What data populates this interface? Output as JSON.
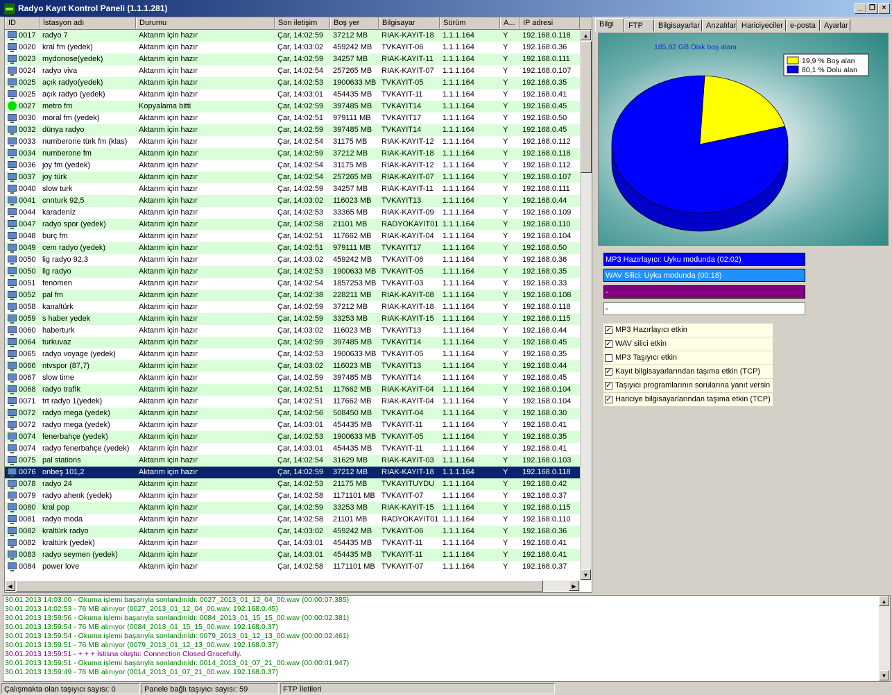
{
  "window": {
    "title": "Radyo Kayıt Kontrol Paneli (1.1.1.281)"
  },
  "grid": {
    "columns": [
      "ID",
      "İstasyon adı",
      "Durumu",
      "Son iletişim",
      "Boş yer",
      "Bilgisayar",
      "Sürüm",
      "A...",
      "IP adresi"
    ],
    "rows": [
      {
        "id": "0017",
        "name": "radyo 7",
        "status": "Aktarım için hazır",
        "last": "Çar, 14:02:59",
        "free": "37212 MB",
        "pc": "RIAK-KAYIT-18",
        "ver": "1.1.1.164",
        "a": "Y",
        "ip": "192.168.0.118",
        "icon": "pc",
        "bg": "g"
      },
      {
        "id": "0020",
        "name": "kral fm (yedek)",
        "status": "Aktarım için hazır",
        "last": "Çar, 14:03:02",
        "free": "459242 MB",
        "pc": "TVKAYIT-06",
        "ver": "1.1.1.164",
        "a": "Y",
        "ip": "192.168.0.36",
        "icon": "pc",
        "bg": "w"
      },
      {
        "id": "0023",
        "name": "mydonose(yedek)",
        "status": "Aktarım için hazır",
        "last": "Çar, 14:02:59",
        "free": "34257 MB",
        "pc": "RIAK-KAYIT-11",
        "ver": "1.1.1.164",
        "a": "Y",
        "ip": "192.168.0.111",
        "icon": "pc",
        "bg": "g"
      },
      {
        "id": "0024",
        "name": "radyo viva",
        "status": "Aktarım için hazır",
        "last": "Çar, 14:02:54",
        "free": "257265 MB",
        "pc": "RIAK-KAYIT-07",
        "ver": "1.1.1.164",
        "a": "Y",
        "ip": "192.168.0.107",
        "icon": "pc",
        "bg": "w"
      },
      {
        "id": "0025",
        "name": "açık radyo(yedek)",
        "status": "Aktarım için hazır",
        "last": "Çar, 14:02:53",
        "free": "1900633 MB",
        "pc": "TVKAYIT-05",
        "ver": "1.1.1.164",
        "a": "Y",
        "ip": "192.168.0.35",
        "icon": "pc",
        "bg": "g"
      },
      {
        "id": "0025",
        "name": "açık radyo (yedek)",
        "status": "Aktarım için hazır",
        "last": "Çar, 14:03:01",
        "free": "454435 MB",
        "pc": "TVKAYIT-11",
        "ver": "1.1.1.164",
        "a": "Y",
        "ip": "192.168.0.41",
        "icon": "pc",
        "bg": "w"
      },
      {
        "id": "0027",
        "name": "metro fm",
        "status": "Kopyalama bitti",
        "last": "Çar, 14:02:59",
        "free": "397485 MB",
        "pc": "TVKAYIT14",
        "ver": "1.1.1.164",
        "a": "Y",
        "ip": "192.168.0.45",
        "icon": "dot",
        "bg": "g"
      },
      {
        "id": "0030",
        "name": "moral fm (yedek)",
        "status": "Aktarım için hazır",
        "last": "Çar, 14:02:51",
        "free": "979111 MB",
        "pc": "TVKAYIT17",
        "ver": "1.1.1.164",
        "a": "Y",
        "ip": "192.168.0.50",
        "icon": "pc",
        "bg": "w"
      },
      {
        "id": "0032",
        "name": "dünya radyo",
        "status": "Aktarım için hazır",
        "last": "Çar, 14:02:59",
        "free": "397485 MB",
        "pc": "TVKAYIT14",
        "ver": "1.1.1.164",
        "a": "Y",
        "ip": "192.168.0.45",
        "icon": "pc",
        "bg": "g"
      },
      {
        "id": "0033",
        "name": "numberone türk fm (klas)",
        "status": "Aktarım için hazır",
        "last": "Çar, 14:02:54",
        "free": "31175 MB",
        "pc": "RIAK-KAYIT-12",
        "ver": "1.1.1.164",
        "a": "Y",
        "ip": "192.168.0.112",
        "icon": "pc",
        "bg": "w"
      },
      {
        "id": "0034",
        "name": "numberone fm",
        "status": "Aktarım için hazır",
        "last": "Çar, 14:02:59",
        "free": "37212 MB",
        "pc": "RIAK-KAYIT-18",
        "ver": "1.1.1.164",
        "a": "Y",
        "ip": "192.168.0.118",
        "icon": "pc",
        "bg": "g"
      },
      {
        "id": "0036",
        "name": "joy fm (yedek)",
        "status": "Aktarım için hazır",
        "last": "Çar, 14:02:54",
        "free": "31175 MB",
        "pc": "RIAK-KAYIT-12",
        "ver": "1.1.1.164",
        "a": "Y",
        "ip": "192.168.0.112",
        "icon": "pc",
        "bg": "w"
      },
      {
        "id": "0037",
        "name": "joy türk",
        "status": "Aktarım için hazır",
        "last": "Çar, 14:02:54",
        "free": "257265 MB",
        "pc": "RIAK-KAYIT-07",
        "ver": "1.1.1.164",
        "a": "Y",
        "ip": "192.168.0.107",
        "icon": "pc",
        "bg": "g"
      },
      {
        "id": "0040",
        "name": "slow turk",
        "status": "Aktarım için hazır",
        "last": "Çar, 14:02:59",
        "free": "34257 MB",
        "pc": "RIAK-KAYIT-11",
        "ver": "1.1.1.164",
        "a": "Y",
        "ip": "192.168.0.111",
        "icon": "pc",
        "bg": "w"
      },
      {
        "id": "0041",
        "name": "cnnturk 92,5",
        "status": "Aktarım için hazır",
        "last": "Çar, 14:03:02",
        "free": "116023 MB",
        "pc": "TVKAYIT13",
        "ver": "1.1.1.164",
        "a": "Y",
        "ip": "192.168.0.44",
        "icon": "pc",
        "bg": "g"
      },
      {
        "id": "0044",
        "name": "karadenİz",
        "status": "Aktarım için hazır",
        "last": "Çar, 14:02:53",
        "free": "33365 MB",
        "pc": "RIAK-KAYIT-09",
        "ver": "1.1.1.164",
        "a": "Y",
        "ip": "192.168.0.109",
        "icon": "pc",
        "bg": "w"
      },
      {
        "id": "0047",
        "name": "radyo spor (yedek)",
        "status": "Aktarım için hazır",
        "last": "Çar, 14:02:58",
        "free": "21101 MB",
        "pc": "RADYOKAYIT01",
        "ver": "1.1.1.164",
        "a": "Y",
        "ip": "192.168.0.110",
        "icon": "pc",
        "bg": "g"
      },
      {
        "id": "0048",
        "name": "burç fm",
        "status": "Aktarım için hazır",
        "last": "Çar, 14:02:51",
        "free": "117662 MB",
        "pc": "RIAK-KAYIT-04",
        "ver": "1.1.1.164",
        "a": "Y",
        "ip": "192.168.0.104",
        "icon": "pc",
        "bg": "w"
      },
      {
        "id": "0049",
        "name": "cem radyo (yedek)",
        "status": "Aktarım için hazır",
        "last": "Çar, 14:02:51",
        "free": "979111 MB",
        "pc": "TVKAYIT17",
        "ver": "1.1.1.164",
        "a": "Y",
        "ip": "192.168.0.50",
        "icon": "pc",
        "bg": "g"
      },
      {
        "id": "0050",
        "name": "lig radyo 92,3",
        "status": "Aktarım için hazır",
        "last": "Çar, 14:03:02",
        "free": "459242 MB",
        "pc": "TVKAYIT-06",
        "ver": "1.1.1.164",
        "a": "Y",
        "ip": "192.168.0.36",
        "icon": "pc",
        "bg": "w"
      },
      {
        "id": "0050",
        "name": "lig radyo",
        "status": "Aktarım için hazır",
        "last": "Çar, 14:02:53",
        "free": "1900633 MB",
        "pc": "TVKAYIT-05",
        "ver": "1.1.1.164",
        "a": "Y",
        "ip": "192.168.0.35",
        "icon": "pc",
        "bg": "g"
      },
      {
        "id": "0051",
        "name": "fenomen",
        "status": "Aktarım için hazır",
        "last": "Çar, 14:02:54",
        "free": "1857253 MB",
        "pc": "TVKAYIT-03",
        "ver": "1.1.1.164",
        "a": "Y",
        "ip": "192.168.0.33",
        "icon": "pc",
        "bg": "w"
      },
      {
        "id": "0052",
        "name": "pal fm",
        "status": "Aktarım için hazır",
        "last": "Çar, 14:02:38",
        "free": "228211 MB",
        "pc": "RIAK-KAYIT-08",
        "ver": "1.1.1.164",
        "a": "Y",
        "ip": "192.168.0.108",
        "icon": "pc",
        "bg": "g"
      },
      {
        "id": "0058",
        "name": "kanaltürk",
        "status": "Aktarım için hazır",
        "last": "Çar, 14:02:59",
        "free": "37212 MB",
        "pc": "RIAK-KAYIT-18",
        "ver": "1.1.1.164",
        "a": "Y",
        "ip": "192.168.0.118",
        "icon": "pc",
        "bg": "w"
      },
      {
        "id": "0059",
        "name": "s haber yedek",
        "status": "Aktarım için hazır",
        "last": "Çar, 14:02:59",
        "free": "33253 MB",
        "pc": "RIAK-KAYIT-15",
        "ver": "1.1.1.164",
        "a": "Y",
        "ip": "192.168.0.115",
        "icon": "pc",
        "bg": "g"
      },
      {
        "id": "0060",
        "name": "haberturk",
        "status": "Aktarım için hazır",
        "last": "Çar, 14:03:02",
        "free": "116023 MB",
        "pc": "TVKAYIT13",
        "ver": "1.1.1.164",
        "a": "Y",
        "ip": "192.168.0.44",
        "icon": "pc",
        "bg": "w"
      },
      {
        "id": "0064",
        "name": "turkuvaz",
        "status": "Aktarım için hazır",
        "last": "Çar, 14:02:59",
        "free": "397485 MB",
        "pc": "TVKAYIT14",
        "ver": "1.1.1.164",
        "a": "Y",
        "ip": "192.168.0.45",
        "icon": "pc",
        "bg": "g"
      },
      {
        "id": "0065",
        "name": "radyo voyage (yedek)",
        "status": "Aktarım için hazır",
        "last": "Çar, 14:02:53",
        "free": "1900633 MB",
        "pc": "TVKAYIT-05",
        "ver": "1.1.1.164",
        "a": "Y",
        "ip": "192.168.0.35",
        "icon": "pc",
        "bg": "w"
      },
      {
        "id": "0066",
        "name": "ntvspor (87,7)",
        "status": "Aktarım için hazır",
        "last": "Çar, 14:03:02",
        "free": "116023 MB",
        "pc": "TVKAYIT13",
        "ver": "1.1.1.164",
        "a": "Y",
        "ip": "192.168.0.44",
        "icon": "pc",
        "bg": "g"
      },
      {
        "id": "0067",
        "name": "slow time",
        "status": "Aktarım için hazır",
        "last": "Çar, 14:02:59",
        "free": "397485 MB",
        "pc": "TVKAYIT14",
        "ver": "1.1.1.164",
        "a": "Y",
        "ip": "192.168.0.45",
        "icon": "pc",
        "bg": "w"
      },
      {
        "id": "0068",
        "name": "radyo trafİk",
        "status": "Aktarım için hazır",
        "last": "Çar, 14:02:51",
        "free": "117662 MB",
        "pc": "RIAK-KAYIT-04",
        "ver": "1.1.1.164",
        "a": "Y",
        "ip": "192.168.0.104",
        "icon": "pc",
        "bg": "g"
      },
      {
        "id": "0071",
        "name": "trt radyo 1(yedek)",
        "status": "Aktarım için hazır",
        "last": "Çar, 14:02:51",
        "free": "117662 MB",
        "pc": "RIAK-KAYIT-04",
        "ver": "1.1.1.164",
        "a": "Y",
        "ip": "192.168.0.104",
        "icon": "pc",
        "bg": "w"
      },
      {
        "id": "0072",
        "name": "radyo mega (yedek)",
        "status": "Aktarım için hazır",
        "last": "Çar, 14:02:56",
        "free": "508450 MB",
        "pc": "TVKAYIT-04",
        "ver": "1.1.1.164",
        "a": "Y",
        "ip": "192.168.0.30",
        "icon": "pc",
        "bg": "g"
      },
      {
        "id": "0072",
        "name": "radyo mega (yedek)",
        "status": "Aktarım için hazır",
        "last": "Çar, 14:03:01",
        "free": "454435 MB",
        "pc": "TVKAYIT-11",
        "ver": "1.1.1.164",
        "a": "Y",
        "ip": "192.168.0.41",
        "icon": "pc",
        "bg": "w"
      },
      {
        "id": "0074",
        "name": "fenerbahçe (yedek)",
        "status": "Aktarım için hazır",
        "last": "Çar, 14:02:53",
        "free": "1900633 MB",
        "pc": "TVKAYIT-05",
        "ver": "1.1.1.164",
        "a": "Y",
        "ip": "192.168.0.35",
        "icon": "pc",
        "bg": "g"
      },
      {
        "id": "0074",
        "name": "radyo fenerbahçe (yedek)",
        "status": "Aktarım için hazır",
        "last": "Çar, 14:03:01",
        "free": "454435 MB",
        "pc": "TVKAYIT-11",
        "ver": "1.1.1.164",
        "a": "Y",
        "ip": "192.168.0.41",
        "icon": "pc",
        "bg": "w"
      },
      {
        "id": "0075",
        "name": "pal stations",
        "status": "Aktarım için hazır",
        "last": "Çar, 14:02:54",
        "free": "31629 MB",
        "pc": "RIAK-KAYIT-03",
        "ver": "1.1.1.164",
        "a": "Y",
        "ip": "192.168.0.103",
        "icon": "pc",
        "bg": "g"
      },
      {
        "id": "0076",
        "name": "onbeş 101,2",
        "status": "Aktarım için hazır",
        "last": "Çar, 14:02:59",
        "free": "37212 MB",
        "pc": "RIAK-KAYIT-18",
        "ver": "1.1.1.164",
        "a": "Y",
        "ip": "192.168.0.118",
        "icon": "pc",
        "bg": "sel"
      },
      {
        "id": "0078",
        "name": "radyo 24",
        "status": "Aktarım için hazır",
        "last": "Çar, 14:02:53",
        "free": "21175 MB",
        "pc": "TVKAYITUYDU",
        "ver": "1.1.1.164",
        "a": "Y",
        "ip": "192.168.0.42",
        "icon": "pc",
        "bg": "g"
      },
      {
        "id": "0079",
        "name": "radyo ahenk (yedek)",
        "status": "Aktarım için hazır",
        "last": "Çar, 14:02:58",
        "free": "1171101 MB",
        "pc": "TVKAYIT-07",
        "ver": "1.1.1.164",
        "a": "Y",
        "ip": "192.168.0.37",
        "icon": "pc",
        "bg": "w"
      },
      {
        "id": "0080",
        "name": "kral pop",
        "status": "Aktarım için hazır",
        "last": "Çar, 14:02:59",
        "free": "33253 MB",
        "pc": "RIAK-KAYIT-15",
        "ver": "1.1.1.164",
        "a": "Y",
        "ip": "192.168.0.115",
        "icon": "pc",
        "bg": "g"
      },
      {
        "id": "0081",
        "name": "radyo moda",
        "status": "Aktarım için hazır",
        "last": "Çar, 14:02:58",
        "free": "21101 MB",
        "pc": "RADYOKAYIT01",
        "ver": "1.1.1.164",
        "a": "Y",
        "ip": "192.168.0.110",
        "icon": "pc",
        "bg": "w"
      },
      {
        "id": "0082",
        "name": "kraltürk radyo",
        "status": "Aktarım için hazır",
        "last": "Çar, 14:03:02",
        "free": "459242 MB",
        "pc": "TVKAYIT-06",
        "ver": "1.1.1.164",
        "a": "Y",
        "ip": "192.168.0.36",
        "icon": "pc",
        "bg": "g"
      },
      {
        "id": "0082",
        "name": "kraltürk (yedek)",
        "status": "Aktarım için hazır",
        "last": "Çar, 14:03:01",
        "free": "454435 MB",
        "pc": "TVKAYIT-11",
        "ver": "1.1.1.164",
        "a": "Y",
        "ip": "192.168.0.41",
        "icon": "pc",
        "bg": "w"
      },
      {
        "id": "0083",
        "name": "radyo seymen (yedek)",
        "status": "Aktarım için hazır",
        "last": "Çar, 14:03:01",
        "free": "454435 MB",
        "pc": "TVKAYIT-11",
        "ver": "1.1.1.164",
        "a": "Y",
        "ip": "192.168.0.41",
        "icon": "pc",
        "bg": "g"
      },
      {
        "id": "0084",
        "name": "power love",
        "status": "Aktarım için hazır",
        "last": "Çar, 14:02:58",
        "free": "1171101 MB",
        "pc": "TVKAYIT-07",
        "ver": "1.1.1.164",
        "a": "Y",
        "ip": "192.168.0.37",
        "icon": "pc",
        "bg": "w"
      }
    ]
  },
  "tabs": [
    "Bilgi",
    "FTP",
    "Bilgisayarlar",
    "Arızalılar",
    "Hariciyeciler",
    "e-posta",
    "Ayarlar"
  ],
  "chart_data": {
    "type": "pie",
    "title": "185,82 GB Disk boş alanı",
    "slices": [
      {
        "label": "19,9 % Boş alan",
        "value": 19.9,
        "color": "#ffff00"
      },
      {
        "label": "80,1 % Dolu alan",
        "value": 80.1,
        "color": "#0000ff"
      }
    ],
    "legend": "top-right"
  },
  "statusbars": [
    {
      "text": "MP3 Hazırlayıcı: Uyku modunda (02:02)",
      "color": "#0000ff"
    },
    {
      "text": "WAV Silici: Uyku modunda (00:18)",
      "color": "#1e90ff"
    },
    {
      "text": "-",
      "color": "#800080"
    },
    {
      "text": "-",
      "color": "#ffffff"
    }
  ],
  "checkboxes": [
    {
      "label": "MP3 Hazırlayıcı etkin",
      "checked": true
    },
    {
      "label": "WAV silici etkin",
      "checked": true
    },
    {
      "label": "MP3 Taşıyıcı etkin",
      "checked": false
    },
    {
      "label": "Kayıt bilgisayarlarından taşıma etkin (TCP)",
      "checked": true
    },
    {
      "label": "Taşıyıcı programlarının sorularına yanıt versin",
      "checked": true
    },
    {
      "label": "Hariciye bilgisayarlarından taşıma etkin (TCP)",
      "checked": true
    }
  ],
  "log": [
    {
      "text": "30.01.2013 14:03:00 - Okuma işlemi başarıyla sonlandırıldı: 0027_2013_01_12_04_00.wav (00:00:07.385)",
      "type": "ok"
    },
    {
      "text": "30.01.2013 14:02:53 - 76 MB alınıyor (0027_2013_01_12_04_00.wav, 192.168.0.45)",
      "type": "ok"
    },
    {
      "text": "30.01.2013 13:59:56 - Okuma işlemi başarıyla sonlandırıldı: 0084_2013_01_15_15_00.wav (00:00:02.381)",
      "type": "ok"
    },
    {
      "text": "30.01.2013 13:59:54 - 76 MB alınıyor (0084_2013_01_15_15_00.wav, 192.168.0.37)",
      "type": "ok"
    },
    {
      "text": "30.01.2013 13:59:54 - Okuma işlemi başarıyla sonlandırıldı: 0079_2013_01_12_13_00.wav (00:00:02.461)",
      "type": "ok"
    },
    {
      "text": "30.01.2013 13:59:51 - 76 MB alınıyor (0079_2013_01_12_13_00.wav, 192.168.0.37)",
      "type": "ok"
    },
    {
      "text": "30.01.2013 13:59:51 -  + + + İstisna oluştu: Connection Closed Gracefully.",
      "type": "err"
    },
    {
      "text": "30.01.2013 13:59:51 - Okuma işlemi başarıyla sonlandırıldı: 0014_2013_01_07_21_00.wav (00:00:01.947)",
      "type": "ok"
    },
    {
      "text": "30.01.2013 13:59:49 - 76 MB alınıyor (0014_2013_01_07_21_00.wav, 192.168.0.37)",
      "type": "ok"
    }
  ],
  "statusbar": {
    "active": "Çalışmakta olan taşıyıcı sayısı: 0",
    "connected": "Panele bağlı taşıyıcı sayısı: 59",
    "ftp": "FTP İletileri"
  }
}
